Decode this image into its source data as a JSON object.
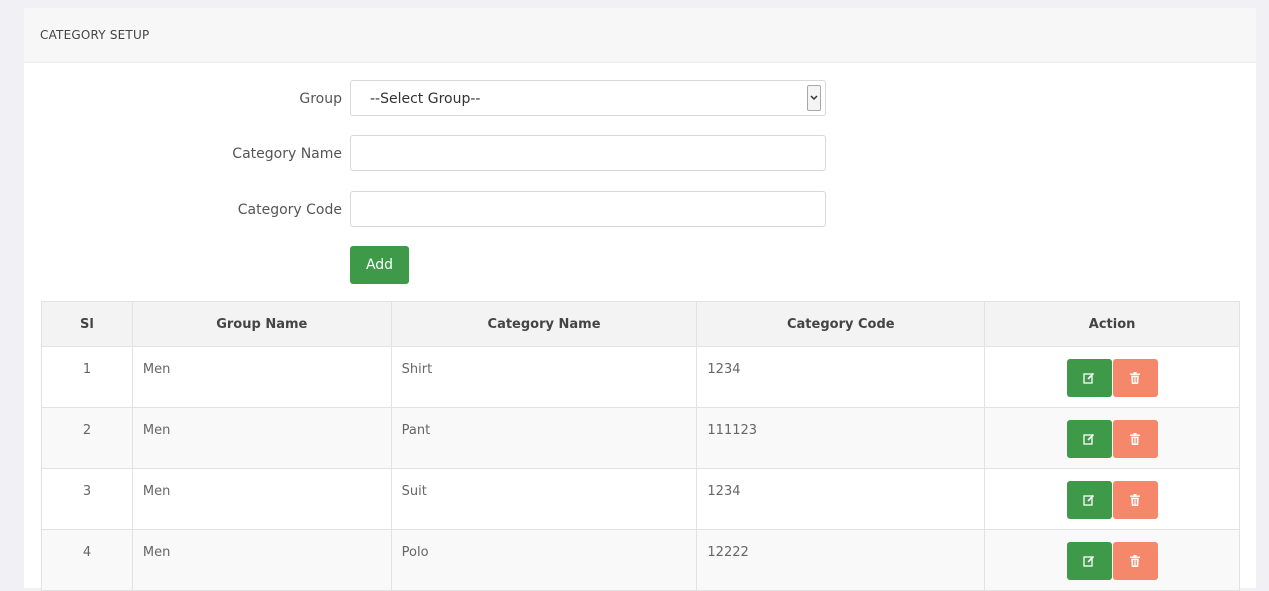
{
  "panel": {
    "title": "CATEGORY SETUP"
  },
  "form": {
    "group": {
      "label": "Group",
      "selected": "--Select Group--"
    },
    "category_name": {
      "label": "Category Name",
      "value": "",
      "placeholder": ""
    },
    "category_code": {
      "label": "Category Code",
      "value": "",
      "placeholder": ""
    },
    "add_label": "Add"
  },
  "table": {
    "headers": [
      "Sl",
      "Group Name",
      "Category Name",
      "Category Code",
      "Action"
    ],
    "rows": [
      {
        "sl": "1",
        "group": "Men",
        "category": "Shirt",
        "code": "1234"
      },
      {
        "sl": "2",
        "group": "Men",
        "category": "Pant",
        "code": "111123"
      },
      {
        "sl": "3",
        "group": "Men",
        "category": "Suit",
        "code": "1234"
      },
      {
        "sl": "4",
        "group": "Men",
        "category": "Polo",
        "code": "12222"
      }
    ]
  },
  "colors": {
    "primary_green": "#3e9a48",
    "delete_orange": "#f5886a"
  },
  "icons": {
    "edit": "edit-icon",
    "delete": "trash-icon",
    "select_arrow": "chevron-down-icon"
  }
}
